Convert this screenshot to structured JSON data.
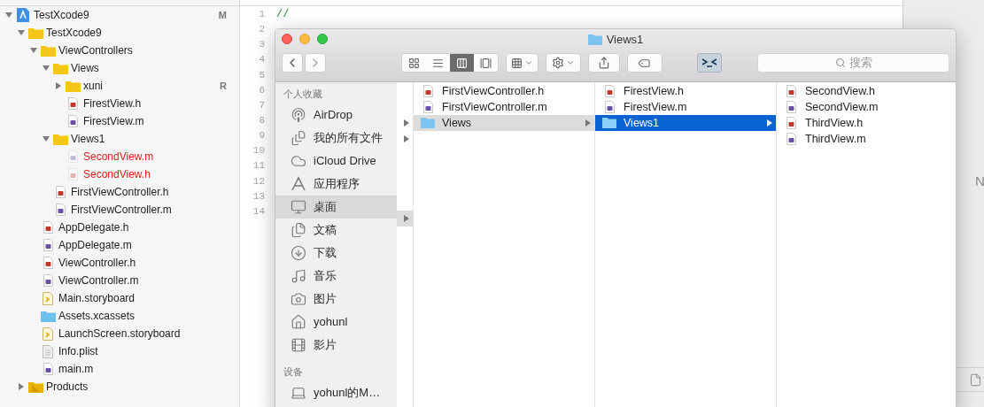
{
  "navigator": {
    "tree": [
      {
        "name": "TestXcode9",
        "kind": "project",
        "expanded": true,
        "badge": "M",
        "children": [
          {
            "name": "TestXcode9",
            "kind": "folder",
            "expanded": true,
            "children": [
              {
                "name": "ViewControllers",
                "kind": "folder",
                "expanded": true,
                "children": [
                  {
                    "name": "Views",
                    "kind": "folder",
                    "expanded": true,
                    "children": [
                      {
                        "name": "xuni",
                        "kind": "folder",
                        "expanded": false,
                        "badge": "R"
                      },
                      {
                        "name": "FirestView.h",
                        "kind": "header",
                        "missing": false
                      },
                      {
                        "name": "FirestView.m",
                        "kind": "source",
                        "missing": false
                      }
                    ]
                  },
                  {
                    "name": "Views1",
                    "kind": "folder",
                    "expanded": true,
                    "children": [
                      {
                        "name": "SecondView.m",
                        "kind": "source",
                        "missing": true
                      },
                      {
                        "name": "SecondView.h",
                        "kind": "header",
                        "missing": true
                      }
                    ]
                  },
                  {
                    "name": "FirstViewController.h",
                    "kind": "header",
                    "missing": false
                  },
                  {
                    "name": "FirstViewController.m",
                    "kind": "source",
                    "missing": false
                  }
                ]
              },
              {
                "name": "AppDelegate.h",
                "kind": "header",
                "missing": false
              },
              {
                "name": "AppDelegate.m",
                "kind": "source",
                "missing": false
              },
              {
                "name": "ViewController.h",
                "kind": "header",
                "missing": false
              },
              {
                "name": "ViewController.m",
                "kind": "source",
                "missing": false
              },
              {
                "name": "Main.storyboard",
                "kind": "storyboard",
                "missing": false
              },
              {
                "name": "Assets.xcassets",
                "kind": "assets",
                "missing": false
              },
              {
                "name": "LaunchScreen.storyboard",
                "kind": "storyboard",
                "missing": false
              },
              {
                "name": "Info.plist",
                "kind": "plist",
                "missing": false
              },
              {
                "name": "main.m",
                "kind": "source",
                "missing": false
              }
            ]
          },
          {
            "name": "Products",
            "kind": "products",
            "expanded": false
          }
        ]
      }
    ]
  },
  "editor": {
    "line_numbers": [
      "1",
      "2",
      "3",
      "4",
      "5",
      "6",
      "7",
      "8",
      "9",
      "10",
      "11",
      "12",
      "13",
      "14"
    ],
    "lines": [
      "//"
    ]
  },
  "inspector": {
    "label": "N"
  },
  "finder": {
    "title": "Views1",
    "toolbar": {
      "view_modes": [
        {
          "kind": "icons",
          "selected": false
        },
        {
          "kind": "list",
          "selected": false
        },
        {
          "kind": "columns",
          "selected": true
        },
        {
          "kind": "gallery",
          "selected": false
        }
      ],
      "search": {
        "placeholder": "搜索"
      }
    },
    "sidebar": [
      {
        "heading": "个人收藏",
        "items": [
          {
            "label": "AirDrop",
            "kind": "airdrop",
            "selected": false
          },
          {
            "label": "我的所有文件",
            "kind": "allfiles",
            "selected": false
          },
          {
            "label": "iCloud Drive",
            "kind": "icloud",
            "selected": false
          },
          {
            "label": "应用程序",
            "kind": "apps",
            "selected": false
          },
          {
            "label": "桌面",
            "kind": "desktop",
            "selected": true
          },
          {
            "label": "文稿",
            "kind": "documents",
            "selected": false
          },
          {
            "label": "下载",
            "kind": "downloads",
            "selected": false
          },
          {
            "label": "音乐",
            "kind": "music",
            "selected": false
          },
          {
            "label": "图片",
            "kind": "pictures",
            "selected": false
          },
          {
            "label": "yohunl",
            "kind": "home",
            "selected": false
          },
          {
            "label": "影片",
            "kind": "movies",
            "selected": false
          }
        ]
      },
      {
        "heading": "设备",
        "items": [
          {
            "label": "yohunl的M…",
            "kind": "computer",
            "selected": false
          }
        ]
      }
    ],
    "partial_column": [
      {
        "has_children": false,
        "selected": false
      },
      {
        "has_children": false,
        "selected": false
      },
      {
        "has_children": true,
        "selected": false
      },
      {
        "has_children": true,
        "selected": false
      },
      {
        "has_children": false,
        "selected": false
      },
      {
        "has_children": false,
        "selected": false
      },
      {
        "has_children": false,
        "selected": false
      },
      {
        "has_children": false,
        "selected": false
      },
      {
        "has_children": true,
        "selected": true
      }
    ],
    "columns": [
      [
        {
          "name": "FirstViewController.h",
          "kind": "header",
          "selected": false
        },
        {
          "name": "FirstViewController.m",
          "kind": "source",
          "selected": false
        },
        {
          "name": "Views",
          "kind": "folder",
          "selected": true
        }
      ],
      [
        {
          "name": "FirestView.h",
          "kind": "header",
          "selected": false
        },
        {
          "name": "FirestView.m",
          "kind": "source",
          "selected": false
        },
        {
          "name": "Views1",
          "kind": "folder",
          "selected": true
        }
      ],
      [
        {
          "name": "SecondView.h",
          "kind": "header",
          "selected": false
        },
        {
          "name": "SecondView.m",
          "kind": "source",
          "selected": false
        },
        {
          "name": "ThirdView.h",
          "kind": "header",
          "selected": false
        },
        {
          "name": "ThirdView.m",
          "kind": "source",
          "selected": false
        }
      ]
    ]
  }
}
